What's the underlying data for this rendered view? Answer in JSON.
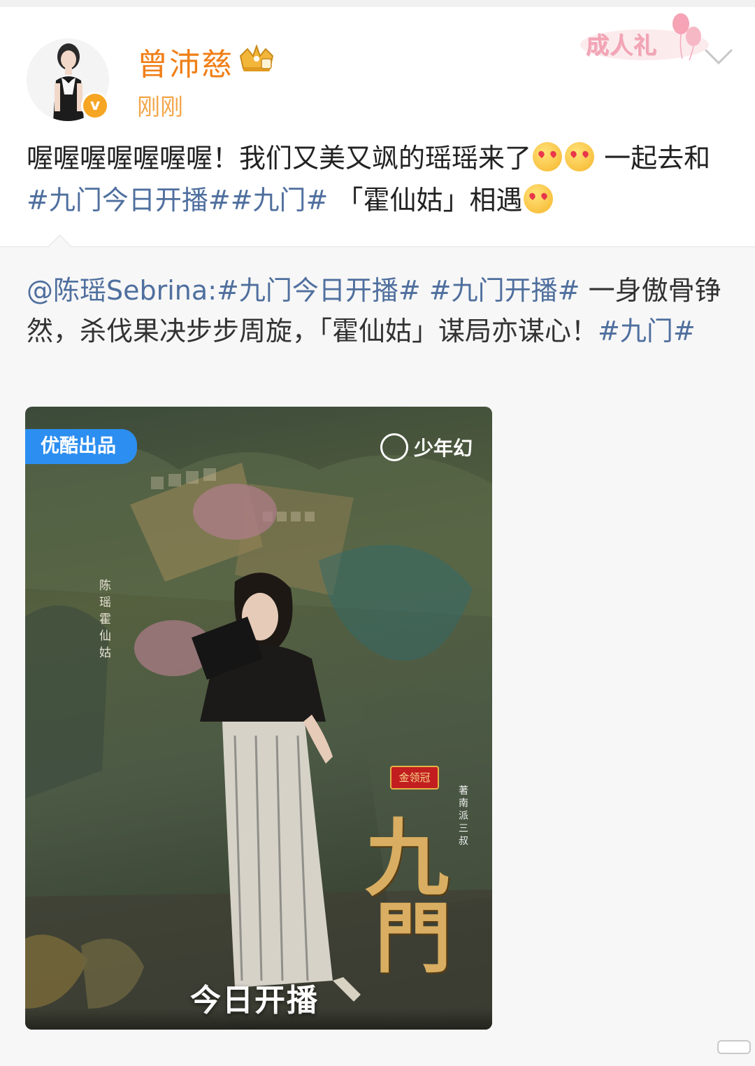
{
  "user": {
    "name": "曾沛慈",
    "time": "刚刚",
    "verified_mark": "v",
    "badge_text": "成人礼"
  },
  "post": {
    "text_part1": "喔喔喔喔喔喔喔！我们又美又飒的瑶瑶来了",
    "text_part2": "一起去和",
    "topic1": "#九门今日开播#",
    "topic2": "#九门#",
    "text_part3": "「霍仙姑」相遇"
  },
  "repost": {
    "mention": "@陈瑶Sebrina",
    "colon": ":",
    "topic1": "#九门今日开播#",
    "topic2": "#九门开播#",
    "text": "一身傲骨铮然，杀伐果决步步周旋，「霍仙姑」谋局亦谋心！",
    "topic3": "#九门#"
  },
  "poster": {
    "badge": "优酷出品",
    "logo": "少年幻",
    "vertical_credit": "陈瑶 霍仙姑",
    "sponsor": "金领冠",
    "title_char1": "九",
    "title_char2": "門",
    "author_credit": "著 南派三叔",
    "premiere": "今日开播"
  },
  "icons": {
    "crown": "crown-icon",
    "chevron": "chevron-down-icon",
    "balloons": "balloon-icon"
  },
  "colors": {
    "username": "#f07f17",
    "topic": "#4f6f9e",
    "youku_blue": "#2c8ef0"
  }
}
